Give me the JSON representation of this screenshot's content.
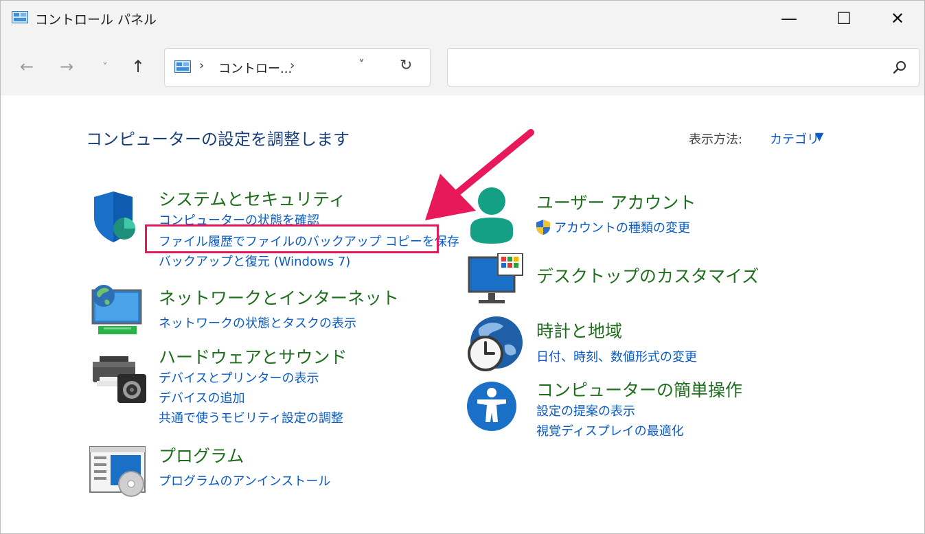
{
  "window": {
    "title": "コントロール パネル",
    "controls": {
      "minimize": "—",
      "maximize": "☐",
      "close": "✕"
    }
  },
  "nav": {
    "back": "←",
    "forward": "→",
    "recent": "˅",
    "up": "↑",
    "address_sep": "›",
    "address_text": "コントロー...",
    "address_dropdown": "˅",
    "refresh": "↻",
    "search_value": ""
  },
  "content": {
    "page_title": "コンピューターの設定を調整します",
    "view_by_label": "表示方法:",
    "view_by_value": "カテゴリ",
    "view_by_caret": "▼",
    "categories": [
      {
        "heading": "システムとセキュリティ",
        "links": [
          "コンピューターの状態を確認",
          "ファイル履歴でファイルのバックアップ コピーを保存",
          "バックアップと復元 (Windows 7)"
        ]
      },
      {
        "heading": "ネットワークとインターネット",
        "links": [
          "ネットワークの状態とタスクの表示"
        ]
      },
      {
        "heading": "ハードウェアとサウンド",
        "links": [
          "デバイスとプリンターの表示",
          "デバイスの追加",
          "共通で使うモビリティ設定の調整"
        ]
      },
      {
        "heading": "プログラム",
        "links": [
          "プログラムのアンインストール"
        ]
      },
      {
        "heading": "ユーザー アカウント",
        "links": [
          "アカウントの種類の変更"
        ]
      },
      {
        "heading": "デスクトップのカスタマイズ",
        "links": []
      },
      {
        "heading": "時計と地域",
        "links": [
          "日付、時刻、数値形式の変更"
        ]
      },
      {
        "heading": "コンピューターの簡単操作",
        "links": [
          "設定の提案の表示",
          "視覚ディスプレイの最適化"
        ]
      }
    ]
  },
  "colors": {
    "heading_green": "#1e6e1e",
    "link_blue": "#0a5bc4",
    "highlight_pink": "#e8195a"
  }
}
